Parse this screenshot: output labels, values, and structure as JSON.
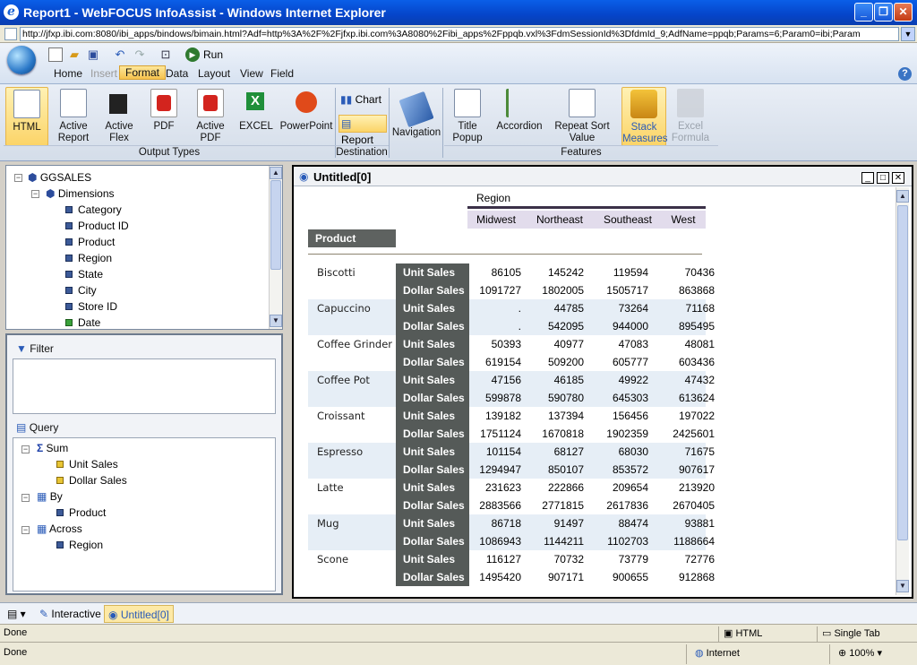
{
  "window": {
    "title": "Report1 - WebFOCUS InfoAssist - Windows Internet Explorer"
  },
  "address": {
    "url": "http://jfxp.ibi.com:8080/ibi_apps/bindows/bimain.html?Adf=http%3A%2F%2Fjfxp.ibi.com%3A8080%2Fibi_apps%2Fppqb.vxl%3FdmSessionId%3DfdmId_9;AdfName=ppqb;Params=6;Param0=ibi;Param"
  },
  "toolbar": {
    "run_label": "Run"
  },
  "menu": {
    "items": [
      "Home",
      "Insert",
      "Format",
      "Data",
      "Layout",
      "View",
      "Field"
    ],
    "selected": "Format",
    "disabled": "Insert"
  },
  "ribbon": {
    "output_types": [
      "HTML",
      "Active Report",
      "Active Flex",
      "PDF",
      "Active PDF",
      "EXCEL",
      "PowerPoint"
    ],
    "output_types_label": "Output Types",
    "destination": [
      "Chart",
      "Report"
    ],
    "destination_label": "Destination",
    "navigation_label": "Navigation",
    "features": [
      "Title Popup",
      "Accordion",
      "Repeat Sort Value",
      "Stack Measures",
      "Excel Formula"
    ],
    "features_label": "Features"
  },
  "tree": {
    "root": "GGSALES",
    "dimensions_label": "Dimensions",
    "items": [
      "Category",
      "Product ID",
      "Product",
      "Region",
      "State",
      "City",
      "Store ID",
      "Date"
    ]
  },
  "filter": {
    "label": "Filter"
  },
  "query": {
    "label": "Query",
    "sum_label": "Sum",
    "sum_items": [
      "Unit Sales",
      "Dollar Sales"
    ],
    "by_label": "By",
    "by_items": [
      "Product"
    ],
    "across_label": "Across",
    "across_items": [
      "Region"
    ]
  },
  "report": {
    "window_title": "Untitled[0]",
    "across_header": "Region",
    "by_header": "Product",
    "regions": [
      "Midwest",
      "Northeast",
      "Southeast",
      "West"
    ],
    "measures": [
      "Unit Sales",
      "Dollar Sales"
    ],
    "rows": [
      {
        "product": "Biscotti",
        "unit": [
          "86105",
          "145242",
          "119594",
          "70436"
        ],
        "dollar": [
          "1091727",
          "1802005",
          "1505717",
          "863868"
        ]
      },
      {
        "product": "Capuccino",
        "unit": [
          ".",
          "44785",
          "73264",
          "71168"
        ],
        "dollar": [
          ".",
          "542095",
          "944000",
          "895495"
        ]
      },
      {
        "product": "Coffee Grinder",
        "unit": [
          "50393",
          "40977",
          "47083",
          "48081"
        ],
        "dollar": [
          "619154",
          "509200",
          "605777",
          "603436"
        ]
      },
      {
        "product": "Coffee Pot",
        "unit": [
          "47156",
          "46185",
          "49922",
          "47432"
        ],
        "dollar": [
          "599878",
          "590780",
          "645303",
          "613624"
        ]
      },
      {
        "product": "Croissant",
        "unit": [
          "139182",
          "137394",
          "156456",
          "197022"
        ],
        "dollar": [
          "1751124",
          "1670818",
          "1902359",
          "2425601"
        ]
      },
      {
        "product": "Espresso",
        "unit": [
          "101154",
          "68127",
          "68030",
          "71675"
        ],
        "dollar": [
          "1294947",
          "850107",
          "853572",
          "907617"
        ]
      },
      {
        "product": "Latte",
        "unit": [
          "231623",
          "222866",
          "209654",
          "213920"
        ],
        "dollar": [
          "2883566",
          "2771815",
          "2617836",
          "2670405"
        ]
      },
      {
        "product": "Mug",
        "unit": [
          "86718",
          "91497",
          "88474",
          "93881"
        ],
        "dollar": [
          "1086943",
          "1144211",
          "1102703",
          "1188664"
        ]
      },
      {
        "product": "Scone",
        "unit": [
          "116127",
          "70732",
          "73779",
          "72776"
        ],
        "dollar": [
          "1495420",
          "907171",
          "900655",
          "912868"
        ]
      }
    ]
  },
  "tabs": {
    "interactive": "Interactive",
    "untitled": "Untitled[0]"
  },
  "status": {
    "app_left": "Done",
    "html": "HTML",
    "single_tab": "Single Tab",
    "ie_left": "Done",
    "zone": "Internet",
    "zoom": "100%"
  }
}
